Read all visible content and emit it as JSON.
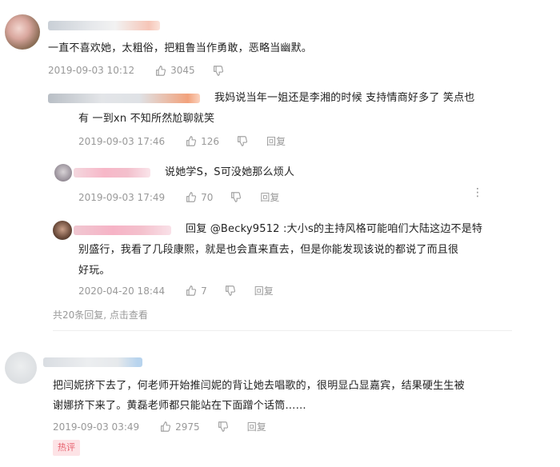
{
  "comments": [
    {
      "text": "一直不喜欢她，太粗俗，把粗鲁当作勇敢，恶略当幽默。",
      "date": "2019-09-03 10:12",
      "likes": "3045",
      "reply_label": ""
    }
  ],
  "replies": [
    {
      "text_line1": "我妈说当年一姐还是李湘的时候 支持情商好多了  笑点也",
      "text_line2": "有  一到xn 不知所然尬聊就笑",
      "date": "2019-09-03 17:46",
      "likes": "126",
      "reply_label": "回复"
    },
    {
      "text": "说她学S，S可没她那么烦人",
      "date": "2019-09-03 17:49",
      "likes": "70",
      "reply_label": "回复"
    },
    {
      "text_line1": "回复 @Becky9512 :大小s的主持风格可能咱们大陆这边不是特",
      "text_line2": "别盛行，我看了几段康熙，就是也会直来直去，但是你能发现该说的都说了而且很",
      "text_line3": "好玩。",
      "date": "2020-04-20 18:44",
      "likes": "7",
      "reply_label": "回复"
    }
  ],
  "more_replies": "共20条回复, 点击查看",
  "comment2": {
    "text_line1": "把闫妮挤下去了，何老师开始推闫妮的背让她去唱歌的，很明显凸显嘉宾，结果硬生生被",
    "text_line2": "谢娜挤下来了。黄磊老师都只能站在下面蹭个话筒……",
    "date": "2019-09-03 03:49",
    "likes": "2975",
    "reply_label": "回复"
  },
  "hot_badge": "热评",
  "more_menu": "⋮",
  "icons": [
    "thumbs-up-icon",
    "thumbs-down-icon",
    "more-options-icon"
  ],
  "colors": {
    "meta_gray": "#999999",
    "hot_badge_bg": "#fde3e6",
    "hot_badge_text": "#e6626f"
  }
}
